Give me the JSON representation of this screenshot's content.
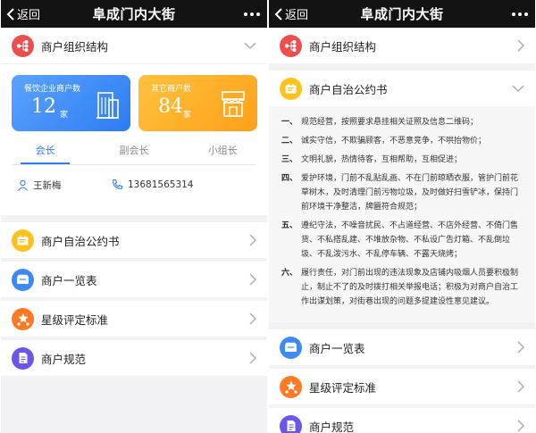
{
  "nav": {
    "back": "返回",
    "title": "阜成门内大街"
  },
  "left": {
    "org_structure": "商户组织结构",
    "stat_catering": {
      "title": "餐饮企业商户数",
      "value": "12",
      "unit": "家"
    },
    "stat_other": {
      "title": "其它商户数",
      "value": "84",
      "unit": "家"
    },
    "tabs": [
      "会长",
      "副会长",
      "小组长"
    ],
    "contact_name": "王新梅",
    "contact_phone": "13681565314",
    "menu": [
      "商户自治公约书",
      "商户一览表",
      "星级评定标准",
      "商户规范"
    ]
  },
  "right": {
    "org_structure": "商户组织结构",
    "covenant": "商户自治公约书",
    "rules": [
      {
        "n": "一、",
        "t": "规范经营，按照要求悬挂相关证照及信息二维码；"
      },
      {
        "n": "二、",
        "t": "诚实守信，不欺骗顾客，不恶意竞争，不哄抬物价；"
      },
      {
        "n": "三、",
        "t": "文明礼貌，热情待客，互相帮助，互相促进；"
      },
      {
        "n": "四、",
        "t": "爱护环境，门前不乱贴乱画、不在门前晾晒衣服，管护门前花草树木，及时清理门前污物垃圾，及时做好扫雪铲冰，保持门前环境干净整洁，牌匾符合规范；"
      },
      {
        "n": "五、",
        "t": "遵纪守法，不噪音扰民、不占道经营、不店外经营、不倚门售货、不私搭乱建、不堆放杂物、不私设广告灯箱、不乱倒垃圾、不乱泼污水、不乱停车辆、不露天烧烤；"
      },
      {
        "n": "六、",
        "t": "履行责任，对门前出现的违法现象及店铺内吸烟人员要积极制止，制止不了的及时拨打相关举报电话；积极为对商户自治工作出谋划策，对街巷出现的问题多提建设性意见建议。"
      }
    ],
    "menu": [
      "商户一览表",
      "星级评定标准",
      "商户规范"
    ]
  },
  "colors": {
    "org_icon": "#f04e4e",
    "covenant_icon": "#ffc21a",
    "list_icon": "#3d8bf2",
    "rating_icon": "#ff7a22",
    "rules_icon": "#6c55e8",
    "active_tab": "#2d7cf2"
  }
}
